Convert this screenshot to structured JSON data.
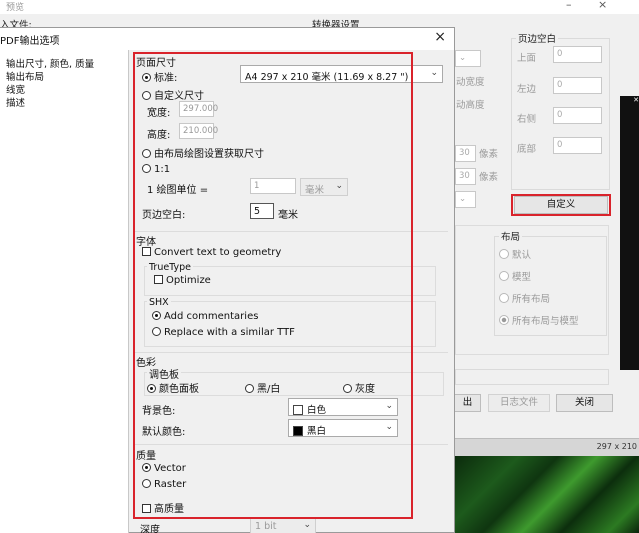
{
  "background": {
    "window_title": "预览",
    "top_labels": {
      "input_file": "入文件:",
      "converter_settings": "转换器设置"
    },
    "mid_labels": {
      "width": "动宽度",
      "height": "动高度"
    },
    "units": {
      "px1": "像素",
      "px2": "像素"
    },
    "margin_group": {
      "title": "页边空白",
      "top": {
        "label": "上面",
        "value": "0"
      },
      "left": {
        "label": "左边",
        "value": "0"
      },
      "right": {
        "label": "右侧",
        "value": "0"
      },
      "bottom": {
        "label": "底部",
        "value": "0"
      },
      "custom_button": "自定义"
    },
    "layout_group": {
      "title": "布局",
      "options": [
        "默认",
        "模型",
        "所有布局",
        "所有布局与模型"
      ]
    },
    "buttons": {
      "partial": "出",
      "log": "日志文件",
      "close": "关闭"
    },
    "status_text": "297 x 210"
  },
  "dialog": {
    "title": "PDF输出选项",
    "close_icon": "×",
    "tree": [
      "输出尺寸, 颜色, 质量",
      "输出布局",
      "线宽",
      "描述"
    ],
    "page_size": {
      "section": "页面尺寸",
      "standard_label": "标准:",
      "standard_value": "A4 297 x 210 毫米 (11.69 x 8.27 \")",
      "custom_label": "自定义尺寸",
      "width_label": "宽度:",
      "width_value": "297.000",
      "height_label": "高度:",
      "height_value": "210.000",
      "from_layout": "由布局绘图设置获取尺寸",
      "ratio_label": "1:1",
      "unit_label": "1 绘图单位 =",
      "unit_value": "1",
      "unit_select": "毫米",
      "margin_label": "页边空白:",
      "margin_value": "5",
      "margin_unit": "毫米"
    },
    "font": {
      "section": "字体",
      "convert": "Convert text to geometry",
      "truetype": "TrueType",
      "optimize": "Optimize",
      "shx": "SHX",
      "add_comments": "Add commentaries",
      "replace_ttf": "Replace with a similar TTF"
    },
    "color": {
      "section": "色彩",
      "palette": "调色板",
      "opt_color": "颜色面板",
      "opt_bw": "黑/白",
      "opt_gray": "灰度",
      "bg_label": "背景色:",
      "bg_value": "白色",
      "default_label": "默认颜色:",
      "default_value": "黑白"
    },
    "quality": {
      "section": "质量",
      "vector": "Vector",
      "raster": "Raster",
      "high": "高质量"
    },
    "depth": {
      "label": "深度",
      "value": "1 bit"
    }
  },
  "colors": {
    "highlight": "#d9232b"
  }
}
